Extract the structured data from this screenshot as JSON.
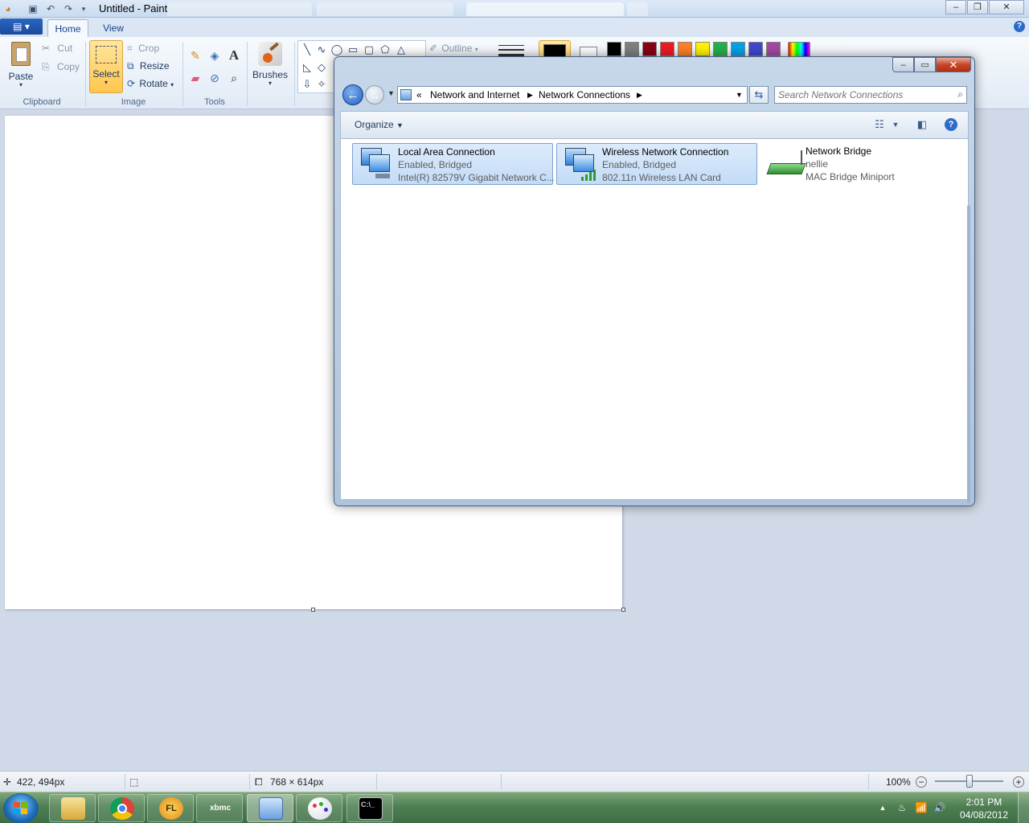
{
  "paint": {
    "title": "Untitled - Paint",
    "app_menu_glyph": "▤ ▾",
    "tabs": [
      "Home",
      "View"
    ],
    "clipboard": {
      "paste": "Paste",
      "cut": "Cut",
      "copy": "Copy",
      "group": "Clipboard"
    },
    "image": {
      "select": "Select",
      "crop": "Crop",
      "resize": "Resize",
      "rotate": "Rotate",
      "group": "Image"
    },
    "tools": {
      "group": "Tools"
    },
    "brushes": "Brushes",
    "shapes": {
      "outline": "Outline"
    },
    "palette": [
      "#000000",
      "#7f7f7f",
      "#880015",
      "#ed1c24",
      "#ff7f27",
      "#fff200",
      "#22b14c",
      "#00a2e8",
      "#3f48cc",
      "#a349a4"
    ],
    "color1": "#000000",
    "color2": "#ffffff"
  },
  "status": {
    "cursor_pos": "422, 494px",
    "image_size": "768 × 614px",
    "zoom": "100%"
  },
  "explorer": {
    "breadcrumb": [
      "Network and Internet",
      "Network Connections"
    ],
    "breadcrumb_prefix": "«",
    "search_placeholder": "Search Network Connections",
    "organize": "Organize",
    "connections": [
      {
        "name": "Local Area Connection",
        "status": "Enabled, Bridged",
        "device": "Intel(R) 82579V Gigabit Network C...",
        "icon": "lan-adapter-icon"
      },
      {
        "name": "Wireless Network Connection",
        "status": "Enabled, Bridged",
        "device": "802.11n Wireless LAN Card",
        "icon": "wireless-adapter-icon"
      },
      {
        "name": "Network Bridge",
        "status": "nellie",
        "device": "MAC Bridge Miniport",
        "icon": "network-bridge-icon"
      }
    ]
  },
  "taskbar": {
    "items": [
      "Windows Explorer",
      "Google Chrome",
      "FL Studio",
      "XBMC",
      "Network Connections",
      "Paint",
      "Command Prompt"
    ],
    "time": "2:01 PM",
    "date": "04/08/2012"
  }
}
